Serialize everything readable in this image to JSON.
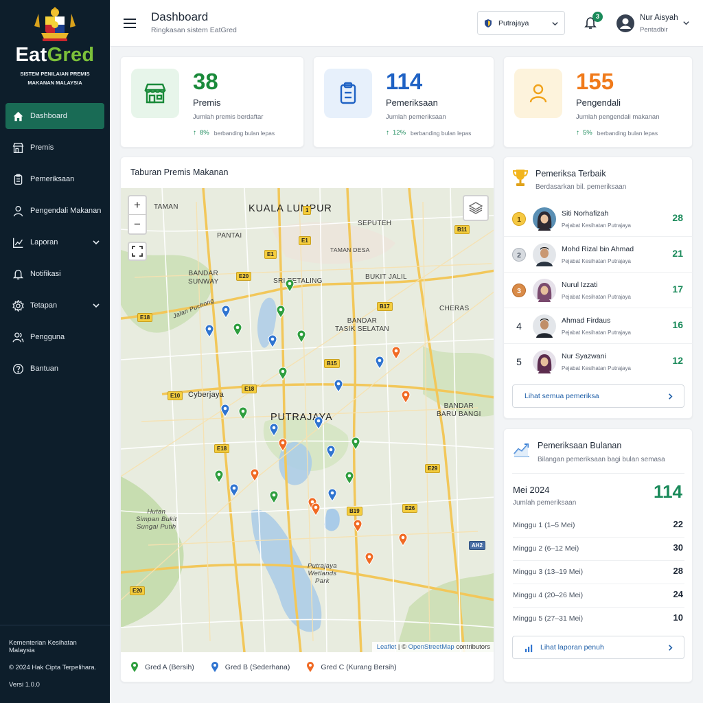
{
  "sidebar": {
    "brand_eat": "Eat",
    "brand_gred": "Gred",
    "brand_sub": "SISTEM PENILAIAN PREMIS MAKANAN MALAYSIA",
    "items": [
      {
        "label": "Dashboard",
        "icon": "home-icon"
      },
      {
        "label": "Premis",
        "icon": "store-icon"
      },
      {
        "label": "Pemeriksaan",
        "icon": "clipboard-icon"
      },
      {
        "label": "Pengendali Makanan",
        "icon": "user-icon"
      },
      {
        "label": "Laporan",
        "icon": "chart-icon"
      },
      {
        "label": "Notifikasi",
        "icon": "bell-icon"
      },
      {
        "label": "Tetapan",
        "icon": "gear-icon"
      },
      {
        "label": "Pengguna",
        "icon": "users-icon"
      },
      {
        "label": "Bantuan",
        "icon": "help-icon"
      }
    ],
    "footer": {
      "ministry": "Kementerian Kesihatan Malaysia",
      "copyright": "© 2024 Hak Cipta Terpelihara.",
      "version": "Versi 1.0.0"
    }
  },
  "header": {
    "title": "Dashboard",
    "subtitle": "Ringkasan sistem EatGred",
    "location": "Putrajaya",
    "notif_count": "3",
    "user_name": "Nur Aisyah",
    "user_role": "Pentadbir"
  },
  "stats": [
    {
      "value": "38",
      "label": "Premis",
      "desc": "Jumlah premis berdaftar",
      "trend": "8%",
      "compare": "berbanding bulan lepas",
      "color": "#1a8a3a"
    },
    {
      "value": "114",
      "label": "Pemeriksaan",
      "desc": "Jumlah pemeriksaan",
      "trend": "12%",
      "compare": "berbanding bulan lepas",
      "color": "#1f62c4"
    },
    {
      "value": "155",
      "label": "Pengendali",
      "desc": "Jumlah pengendali makanan",
      "trend": "5%",
      "compare": "berbanding bulan lepas",
      "color": "#f07a1a"
    }
  ],
  "map": {
    "title": "Taburan Premis Makanan",
    "zoom_in": "+",
    "zoom_out": "−",
    "labels": {
      "kl": "KUALA LUMPUR",
      "putrajaya": "PUTRAJAYA",
      "cyberjaya": "Cyberjaya",
      "taman": "TAMAN",
      "sentul": "SEPUTEH",
      "pantai": "PANTAI",
      "taman_desa": "TAMAN DESA",
      "bandar_sunway": "BANDAR\nSUNWAY",
      "sri_petaling": "SRI PETALING",
      "bukit_jalil": "BUKIT JALIL",
      "cheras": "CHERAS",
      "jalan_puchong": "Jalan Puchong",
      "tasik_selatan": "BANDAR\nTASIK SELATAN",
      "baru_bangi": "BANDAR\nBARU BANGI",
      "hutan": "Hutan\nSimpan Bukit\nSungai Putih",
      "wetlands": "Putrajaya\nWetlands\nPark"
    },
    "attribution_leaflet": "Leaflet",
    "attribution_sep": " | © ",
    "attribution_osm": "OpenStreetMap",
    "attribution_tail": " contributors",
    "legend": [
      {
        "label": "Gred A (Bersih)",
        "color": "#2e9e3e"
      },
      {
        "label": "Gred B (Sederhana)",
        "color": "#2f74d0"
      },
      {
        "label": "Gred C (Kurang Bersih)",
        "color": "#f06a24"
      }
    ]
  },
  "ranking": {
    "title": "Pemeriksa Terbaik",
    "subtitle": "Berdasarkan bil. pemeriksaan",
    "rows": [
      {
        "rank": "1",
        "name": "Siti Norhafizah",
        "org": "Pejabat Kesihatan Putrajaya",
        "count": "28"
      },
      {
        "rank": "2",
        "name": "Mohd Rizal bin Ahmad",
        "org": "Pejabat Kesihatan Putrajaya",
        "count": "21"
      },
      {
        "rank": "3",
        "name": "Nurul Izzati",
        "org": "Pejabat Kesihatan Putrajaya",
        "count": "17"
      },
      {
        "rank": "4",
        "name": "Ahmad Firdaus",
        "org": "Pejabat Kesihatan Putrajaya",
        "count": "16"
      },
      {
        "rank": "5",
        "name": "Nur Syazwani",
        "org": "Pejabat Kesihatan Putrajaya",
        "count": "12"
      }
    ],
    "view_all": "Lihat semua pemeriksa"
  },
  "monthly": {
    "title": "Pemeriksaan Bulanan",
    "subtitle": "Bilangan pemeriksaan bagi bulan semasa",
    "month": "Mei 2024",
    "total_label": "Jumlah pemeriksaan",
    "total": "114",
    "weeks": [
      {
        "label": "Minggu 1   (1–5 Mei)",
        "value": "22"
      },
      {
        "label": "Minggu 2   (6–12 Mei)",
        "value": "30"
      },
      {
        "label": "Minggu 3   (13–19 Mei)",
        "value": "28"
      },
      {
        "label": "Minggu 4   (20–26 Mei)",
        "value": "24"
      },
      {
        "label": "Minggu 5   (27–31 Mei)",
        "value": "10"
      }
    ],
    "full_report": "Lihat laporan penuh"
  }
}
